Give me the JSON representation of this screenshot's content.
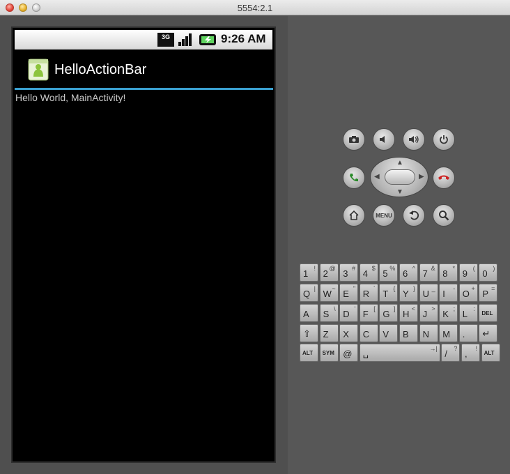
{
  "window": {
    "title": "5554:2.1"
  },
  "statusbar": {
    "network_label": "3G",
    "time": "9:26 AM"
  },
  "app": {
    "title": "HelloActionBar",
    "content_text": "Hello World, MainActivity!"
  },
  "icons": [
    "camera-icon",
    "volume-down-icon",
    "volume-up-icon",
    "power-icon",
    "call-icon",
    "end-call-icon",
    "home-icon",
    "back-icon",
    "search-icon"
  ],
  "controls": {
    "menu_label": "MENU"
  },
  "keyboard": {
    "rows": [
      [
        {
          "m": "1",
          "s": "!"
        },
        {
          "m": "2",
          "s": "@"
        },
        {
          "m": "3",
          "s": "#"
        },
        {
          "m": "4",
          "s": "$"
        },
        {
          "m": "5",
          "s": "%"
        },
        {
          "m": "6",
          "s": "^"
        },
        {
          "m": "7",
          "s": "&"
        },
        {
          "m": "8",
          "s": "*"
        },
        {
          "m": "9",
          "s": "("
        },
        {
          "m": "0",
          "s": ")"
        }
      ],
      [
        {
          "m": "Q",
          "s": "|"
        },
        {
          "m": "W",
          "s": "~"
        },
        {
          "m": "E",
          "s": "\""
        },
        {
          "m": "R",
          "s": "`"
        },
        {
          "m": "T",
          "s": "{"
        },
        {
          "m": "Y",
          "s": "}"
        },
        {
          "m": "U",
          "s": "_"
        },
        {
          "m": "I",
          "s": "-"
        },
        {
          "m": "O",
          "s": "+"
        },
        {
          "m": "P",
          "s": "="
        }
      ],
      [
        {
          "m": "A",
          "s": ""
        },
        {
          "m": "S",
          "s": "\\"
        },
        {
          "m": "D",
          "s": "'"
        },
        {
          "m": "F",
          "s": "["
        },
        {
          "m": "G",
          "s": "]"
        },
        {
          "m": "H",
          "s": "<"
        },
        {
          "m": "J",
          "s": ">"
        },
        {
          "m": "K",
          "s": ";"
        },
        {
          "m": "L",
          "s": ":"
        },
        {
          "m": "DEL",
          "s": ""
        }
      ],
      [
        {
          "m": "⇧",
          "s": ""
        },
        {
          "m": "Z",
          "s": ""
        },
        {
          "m": "X",
          "s": ""
        },
        {
          "m": "C",
          "s": ""
        },
        {
          "m": "V",
          "s": ""
        },
        {
          "m": "B",
          "s": ""
        },
        {
          "m": "N",
          "s": ""
        },
        {
          "m": "M",
          "s": ""
        },
        {
          "m": ".",
          "s": ""
        },
        {
          "m": "↵",
          "s": ""
        }
      ],
      [
        {
          "m": "ALT",
          "s": ""
        },
        {
          "m": "SYM",
          "s": ""
        },
        {
          "m": "@",
          "s": ""
        },
        {
          "m": "␣",
          "s": "→|"
        },
        {
          "m": "/",
          "s": "?"
        },
        {
          "m": ",",
          "s": "!"
        },
        {
          "m": "ALT",
          "s": ""
        }
      ]
    ]
  }
}
